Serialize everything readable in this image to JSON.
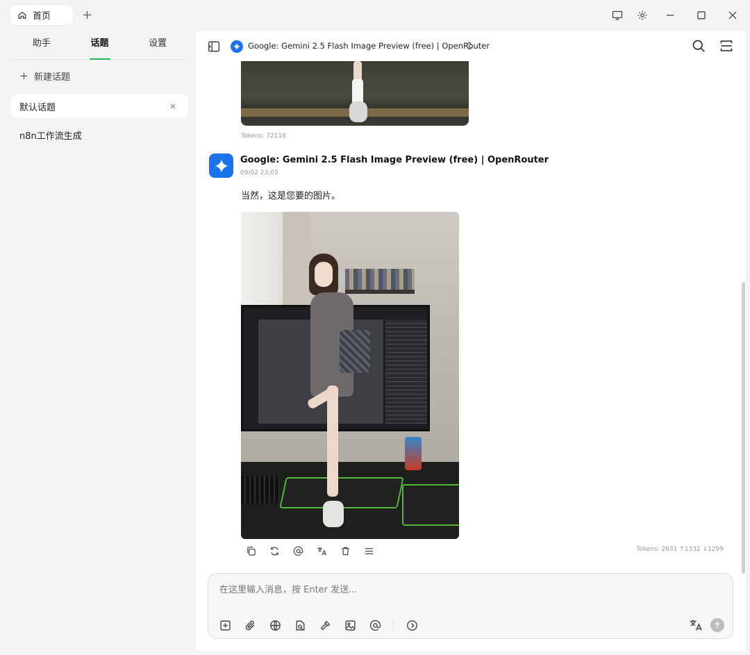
{
  "titlebar": {
    "home_tab_label": "首页",
    "icons": [
      "home-icon",
      "plus-icon",
      "monitor-icon",
      "gear-icon",
      "minimize-icon",
      "maximize-icon",
      "close-icon"
    ]
  },
  "sidebar": {
    "tabs": [
      {
        "label": "助手",
        "active": false
      },
      {
        "label": "话题",
        "active": true
      },
      {
        "label": "设置",
        "active": false
      }
    ],
    "new_topic_label": "新建话题",
    "topics": [
      {
        "label": "默认话题",
        "active": true
      },
      {
        "label": "n8n工作流生成",
        "active": false
      }
    ],
    "accent_color": "#1db954"
  },
  "header": {
    "model_name": "Google: Gemini 2.5 Flash Image Preview (free) | OpenRouter"
  },
  "messages": {
    "previous": {
      "tokens": "Tokens: 72118"
    },
    "current": {
      "model_name": "Google: Gemini 2.5 Flash Image Preview (free) | OpenRouter",
      "time": "09/02 23:05",
      "text": "当然，这是您要的图片。",
      "tokens": "Tokens: 2631 ↑1332 ↓1299",
      "actions": [
        "copy-icon",
        "regenerate-icon",
        "mention-icon",
        "translate-icon",
        "delete-icon",
        "menu-icon"
      ]
    }
  },
  "input": {
    "placeholder": "在这里输入消息，按 Enter 发送...",
    "tools": [
      "new-topic-icon",
      "attachment-icon",
      "web-search-icon",
      "knowledge-icon",
      "tools-icon",
      "image-icon",
      "mention-icon",
      "more-icon"
    ]
  },
  "colors": {
    "gemini_blue": "#1a73e8",
    "background": "#f3f3f3"
  }
}
